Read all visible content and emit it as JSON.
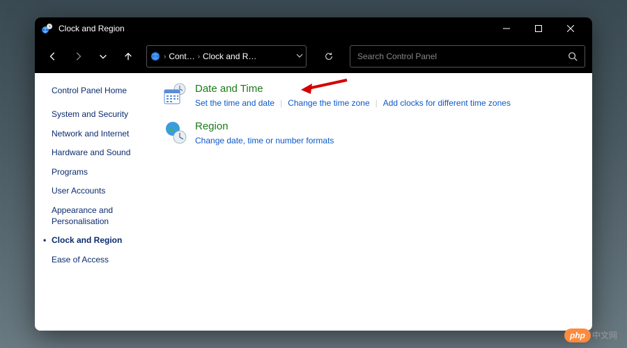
{
  "title": "Clock and Region",
  "breadcrumb": {
    "seg1": "Cont…",
    "seg2": "Clock and R…"
  },
  "search": {
    "placeholder": "Search Control Panel"
  },
  "sidebar": {
    "home": "Control Panel Home",
    "items": [
      {
        "label": "System and Security"
      },
      {
        "label": "Network and Internet"
      },
      {
        "label": "Hardware and Sound"
      },
      {
        "label": "Programs"
      },
      {
        "label": "User Accounts"
      },
      {
        "label": "Appearance and Personalisation"
      },
      {
        "label": "Clock and Region",
        "active": true
      },
      {
        "label": "Ease of Access"
      }
    ]
  },
  "categories": [
    {
      "title": "Date and Time",
      "links": [
        "Set the time and date",
        "Change the time zone",
        "Add clocks for different time zones"
      ]
    },
    {
      "title": "Region",
      "links": [
        "Change date, time or number formats"
      ]
    }
  ],
  "watermark": {
    "badge": "php",
    "text": "中文网"
  }
}
